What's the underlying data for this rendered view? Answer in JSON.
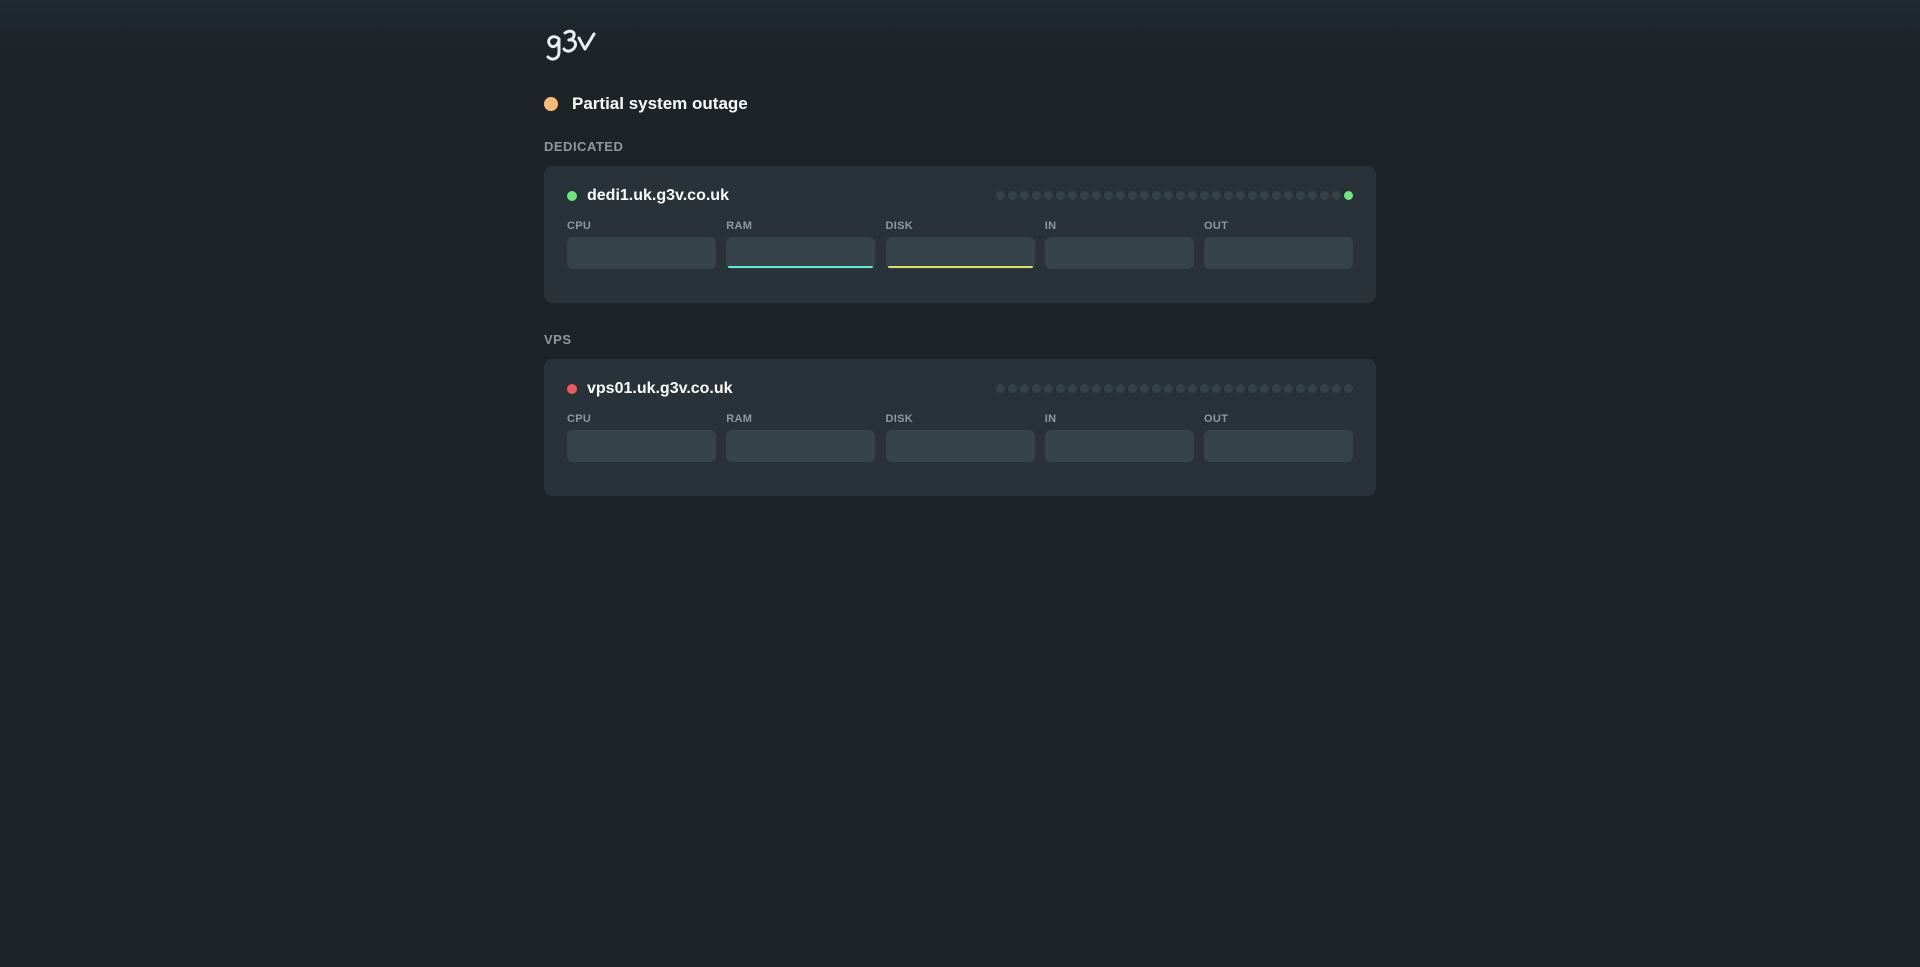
{
  "brand": {
    "logo_text": "g3v"
  },
  "overall_status": {
    "text": "Partial system outage",
    "color": "#fdba74"
  },
  "sections": [
    {
      "label": "DEDICATED",
      "hosts": [
        {
          "name": "dedi1.uk.g3v.co.uk",
          "status_color": "#6ee77d",
          "history": [
            "empty",
            "empty",
            "empty",
            "empty",
            "empty",
            "empty",
            "empty",
            "empty",
            "empty",
            "empty",
            "empty",
            "empty",
            "empty",
            "empty",
            "empty",
            "empty",
            "empty",
            "empty",
            "empty",
            "empty",
            "empty",
            "empty",
            "empty",
            "empty",
            "empty",
            "empty",
            "empty",
            "empty",
            "empty",
            "up"
          ],
          "metrics": [
            {
              "label": "CPU",
              "line_color": null
            },
            {
              "label": "RAM",
              "line_color": "#5eead4"
            },
            {
              "label": "DISK",
              "line_color": "#d9e06a"
            },
            {
              "label": "IN",
              "line_color": null
            },
            {
              "label": "OUT",
              "line_color": null
            }
          ]
        }
      ]
    },
    {
      "label": "VPS",
      "hosts": [
        {
          "name": "vps01.uk.g3v.co.uk",
          "status_color": "#f0595e",
          "history": [
            "empty",
            "empty",
            "empty",
            "empty",
            "empty",
            "empty",
            "empty",
            "empty",
            "empty",
            "empty",
            "empty",
            "empty",
            "empty",
            "empty",
            "empty",
            "empty",
            "empty",
            "empty",
            "empty",
            "empty",
            "empty",
            "empty",
            "empty",
            "empty",
            "empty",
            "empty",
            "empty",
            "empty",
            "empty",
            "empty"
          ],
          "metrics": [
            {
              "label": "CPU",
              "line_color": null
            },
            {
              "label": "RAM",
              "line_color": null
            },
            {
              "label": "DISK",
              "line_color": null
            },
            {
              "label": "IN",
              "line_color": null
            },
            {
              "label": "OUT",
              "line_color": null
            }
          ]
        }
      ]
    }
  ],
  "colors": {
    "history_empty": "#36424a",
    "history_up": "#6ee77d"
  }
}
